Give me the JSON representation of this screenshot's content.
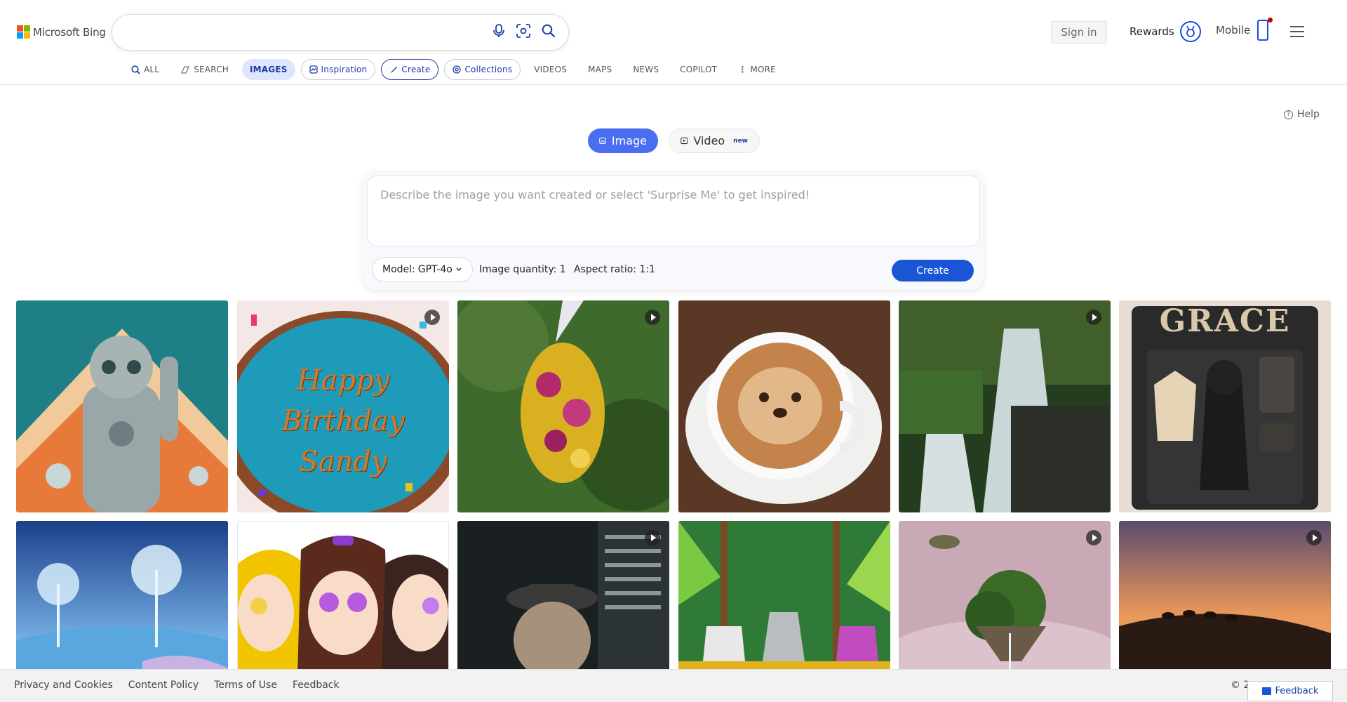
{
  "logo": {
    "text": "Microsoft Bing"
  },
  "search": {
    "value": ""
  },
  "header": {
    "signin": "Sign in",
    "rewards": "Rewards",
    "mobile": "Mobile"
  },
  "nav": {
    "all": "ALL",
    "search": "SEARCH",
    "images": "IMAGES",
    "inspiration": "Inspiration",
    "create": "Create",
    "collections": "Collections",
    "videos": "VIDEOS",
    "maps": "MAPS",
    "news": "NEWS",
    "copilot": "COPILOT",
    "more": "MORE"
  },
  "help": "Help",
  "mode": {
    "image": "Image",
    "video": "Video",
    "video_badge": "new"
  },
  "prompt": {
    "placeholder": "Describe the image you want created or select 'Surprise Me' to get inspired!",
    "model_label": "Model:",
    "model_value": "GPT-4o",
    "quantity": "Image quantity: 1",
    "aspect": "Aspect ratio: 1:1",
    "create": "Create"
  },
  "gallery": {
    "cake_text": "Happy Birthday Sandy",
    "grace_text": "GRACE"
  },
  "footer": {
    "links": [
      "Privacy and Cookies",
      "Content Policy",
      "Terms of Use",
      "Feedback"
    ],
    "copyright": "© 2",
    "feedback_button": "Feedback"
  }
}
